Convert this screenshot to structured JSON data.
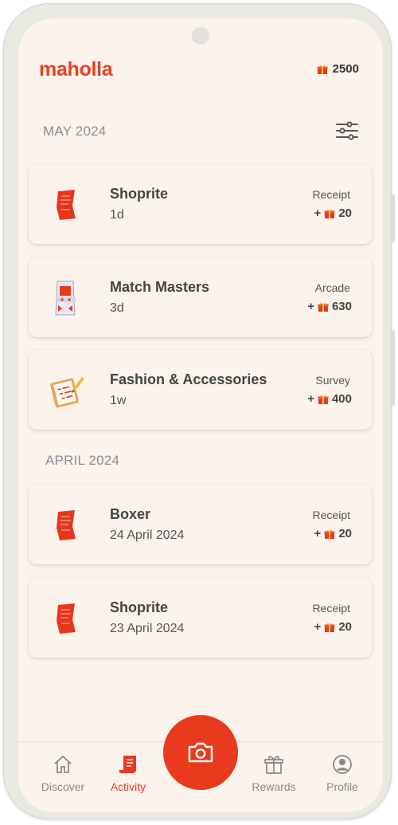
{
  "app": {
    "logo": "maholla",
    "balance": "2500"
  },
  "sections": [
    {
      "month": "MAY 2024",
      "items": [
        {
          "title": "Shoprite",
          "time": "1d",
          "type": "Receipt",
          "points": "20",
          "icon": "receipt-icon"
        },
        {
          "title": "Match Masters",
          "time": "3d",
          "type": "Arcade",
          "points": "630",
          "icon": "arcade-machine-icon"
        },
        {
          "title": "Fashion & Accessories",
          "time": "1w",
          "type": "Survey",
          "points": "400",
          "icon": "survey-clipboard-icon"
        }
      ]
    },
    {
      "month": "APRIL 2024",
      "items": [
        {
          "title": "Boxer",
          "time": "24 April 2024",
          "type": "Receipt",
          "points": "20",
          "icon": "receipt-icon"
        },
        {
          "title": "Shoprite",
          "time": "23 April 2024",
          "type": "Receipt",
          "points": "20",
          "icon": "receipt-icon"
        }
      ]
    }
  ],
  "points_prefix": "+",
  "nav": {
    "discover": "Discover",
    "activity": "Activity",
    "rewards": "Rewards",
    "profile": "Profile",
    "active": "activity"
  },
  "colors": {
    "brand": "#ea3e23",
    "background": "#fcf4ec",
    "muted": "#8a8d93"
  }
}
